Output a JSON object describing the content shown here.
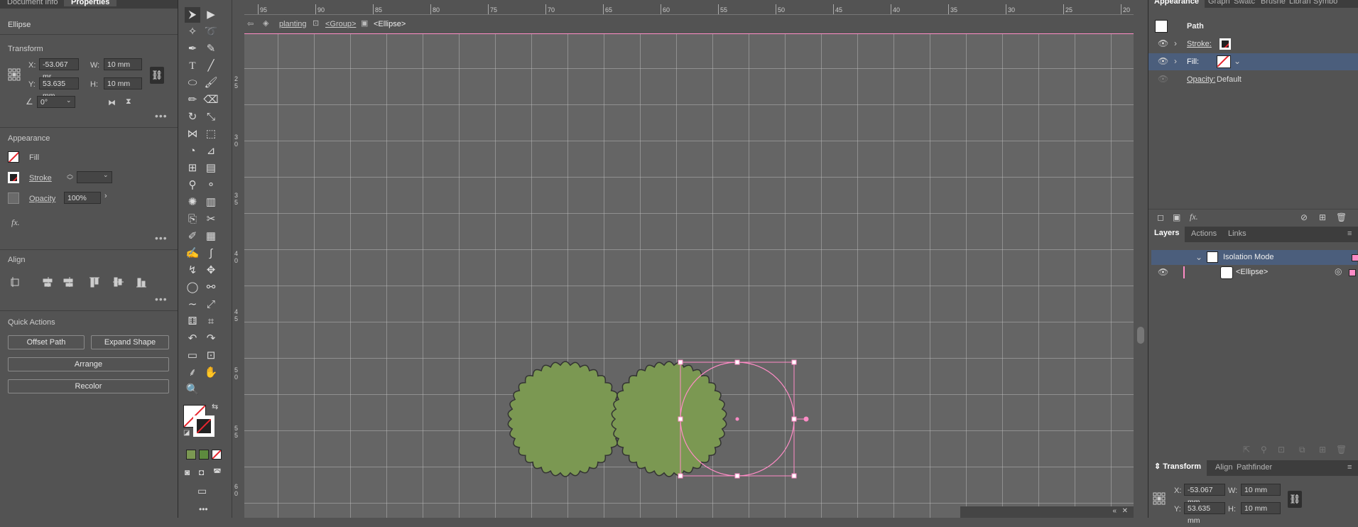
{
  "properties_panel": {
    "tabs": [
      "Document Info",
      "Properties"
    ],
    "object_type": "Ellipse",
    "transform": {
      "title": "Transform",
      "x_label": "X:",
      "x_value": "-53.067 mr",
      "y_label": "Y:",
      "y_value": "53.635 mm",
      "w_label": "W:",
      "w_value": "10 mm",
      "h_label": "H:",
      "h_value": "10 mm",
      "angle_value": "0°"
    },
    "appearance": {
      "title": "Appearance",
      "fill_label": "Fill",
      "stroke_label": "Stroke",
      "opacity_label": "Opacity",
      "opacity_value": "100%",
      "fx_label": "fx."
    },
    "align": {
      "title": "Align"
    },
    "quick_actions": {
      "title": "Quick Actions",
      "offset_path": "Offset Path",
      "expand_shape": "Expand Shape",
      "arrange": "Arrange",
      "recolor": "Recolor"
    }
  },
  "breadcrumb": {
    "items": [
      "planting",
      "<Group>",
      "<Ellipse>"
    ]
  },
  "rulers": {
    "horizontal": [
      "95",
      "90",
      "85",
      "80",
      "75",
      "70",
      "65",
      "60",
      "55",
      "50",
      "45",
      "40",
      "35",
      "30",
      "25",
      "20"
    ],
    "vertical": [
      "2\n5",
      "3\n0",
      "3\n5",
      "4\n0",
      "4\n5",
      "5\n0",
      "5\n5",
      "6\n0"
    ]
  },
  "canvas": {
    "shape_fill_color": "#7b9852",
    "selection_color": "#ff8cc6"
  },
  "appearance_panel": {
    "tabs": [
      "Appearance",
      "Graph",
      "Swatc",
      "Brushe",
      "Librari",
      "Symbo"
    ],
    "header": "Path",
    "stroke_label": "Stroke:",
    "fill_label": "Fill:",
    "opacity_label": "Opacity:",
    "opacity_value": "Default"
  },
  "layers_panel": {
    "tabs": [
      "Layers",
      "Actions",
      "Links"
    ],
    "rows": [
      {
        "name": "Isolation Mode"
      },
      {
        "name": "<Ellipse>"
      }
    ]
  },
  "transform_panel": {
    "tabs": [
      "Transform",
      "Align",
      "Pathfinder"
    ],
    "x_label": "X:",
    "x_value": "-53.067 mm",
    "y_label": "Y:",
    "y_value": "53.635 mm",
    "w_label": "W:",
    "w_value": "10 mm",
    "h_label": "H:",
    "h_value": "10 mm"
  },
  "colors": {
    "accent_blue": "#4b5e7c",
    "selection_pink": "#ff8cc6",
    "none_red": "#e8262e"
  }
}
